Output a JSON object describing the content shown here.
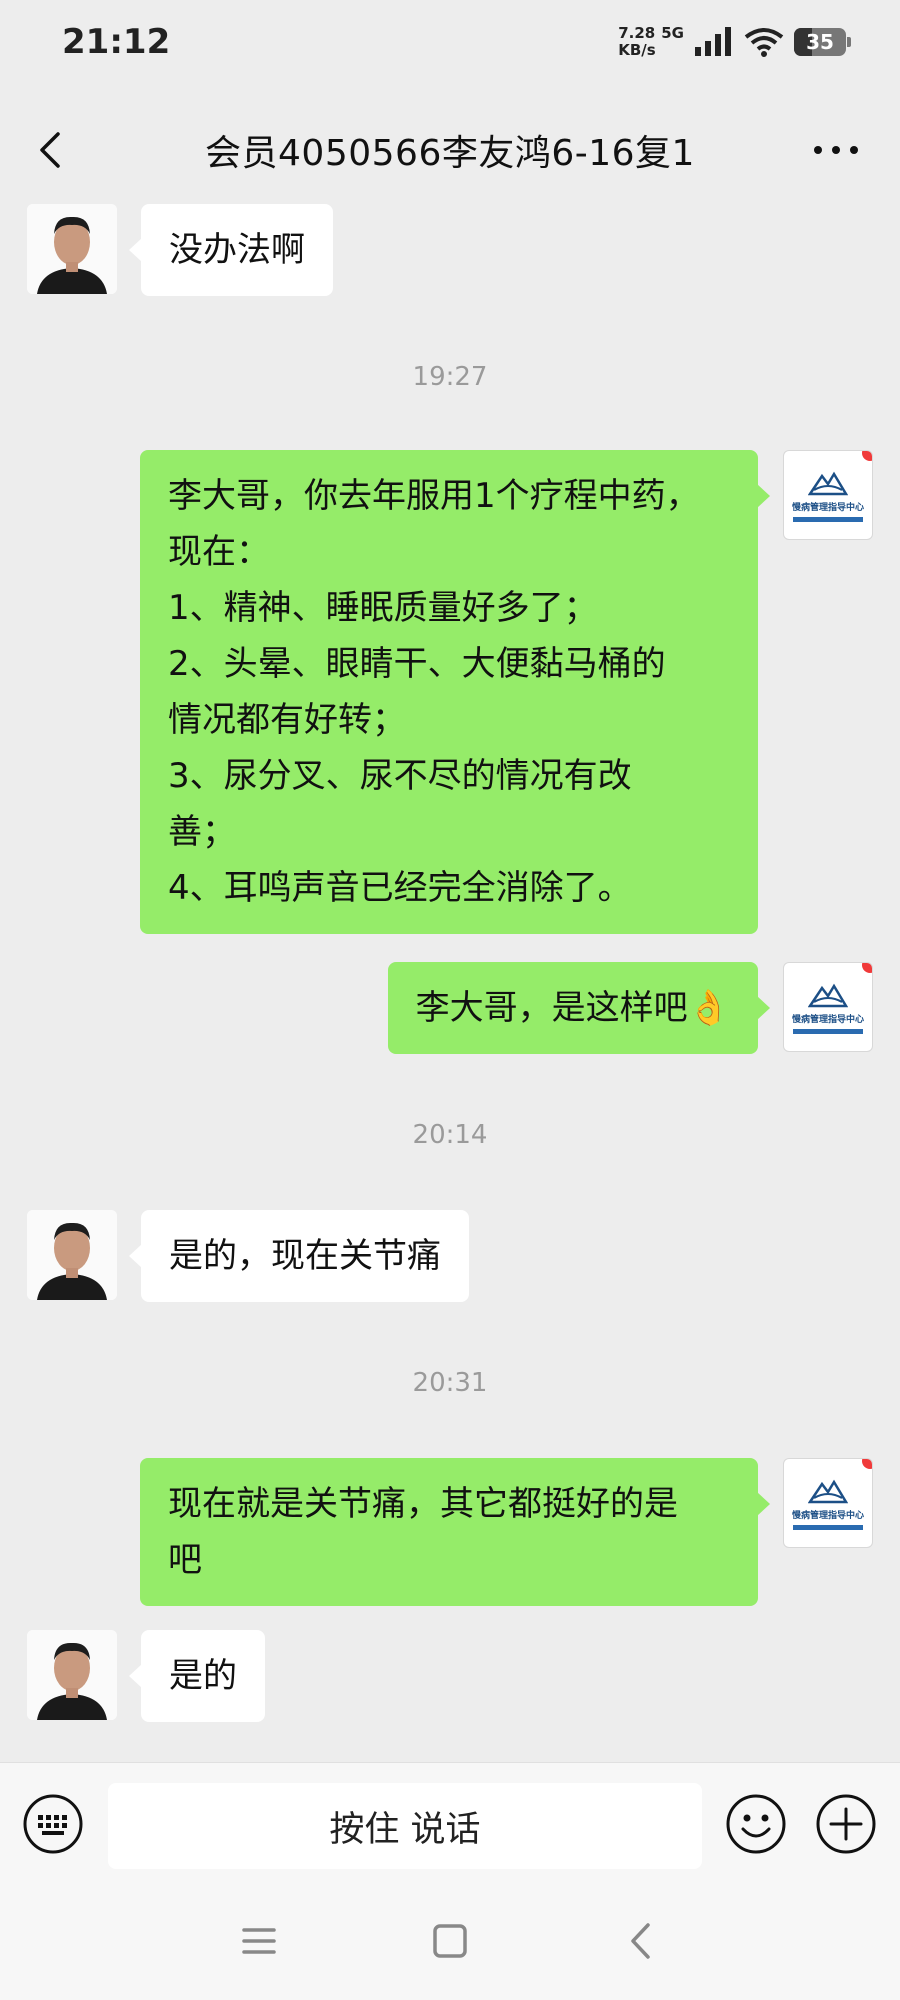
{
  "status_bar": {
    "time": "21:12",
    "net_speed_value": "7.28",
    "net_type": "5G",
    "net_speed_unit": "KB/s",
    "battery": "35"
  },
  "header": {
    "title": "会员4050566李友鸿6-16复1",
    "back_icon": "chevron-left-icon",
    "more_icon": "more-horizontal-icon"
  },
  "messages": [
    {
      "side": "left",
      "lines": [
        "没办法啊"
      ]
    },
    {
      "timestamp": "19:27"
    },
    {
      "side": "right",
      "lines": [
        "李大哥，你去年服用1个疗程中药，",
        "现在：",
        "1、精神、睡眠质量好多了；",
        "2、头晕、眼睛干、大便黏马桶的",
        "情况都有好转；",
        "3、尿分叉、尿不尽的情况有改",
        "善；",
        "4、耳鸣声音已经完全消除了。"
      ]
    },
    {
      "side": "right",
      "lines": [
        "李大哥，是这样吧👌"
      ]
    },
    {
      "timestamp": "20:14"
    },
    {
      "side": "left",
      "lines": [
        "是的，现在关节痛"
      ]
    },
    {
      "timestamp": "20:31"
    },
    {
      "side": "right",
      "lines": [
        "现在就是关节痛，其它都挺好的是",
        "吧"
      ]
    },
    {
      "side": "left",
      "lines": [
        "是的"
      ]
    }
  ],
  "clinic_avatar": {
    "name": "慢病管理指导中心"
  },
  "input_bar": {
    "voice_label": "按住 说话",
    "keyboard_icon": "keyboard-icon",
    "emoji_icon": "emoji-icon",
    "plus_icon": "plus-circle-icon"
  },
  "nav_bar": {
    "icons": [
      "menu-icon",
      "home-square-icon",
      "back-triangle-icon"
    ]
  },
  "colors": {
    "background": "#ededed",
    "bubble_sent": "#95ec69",
    "bubble_received": "#ffffff",
    "unread_dot": "#f03a3a"
  }
}
